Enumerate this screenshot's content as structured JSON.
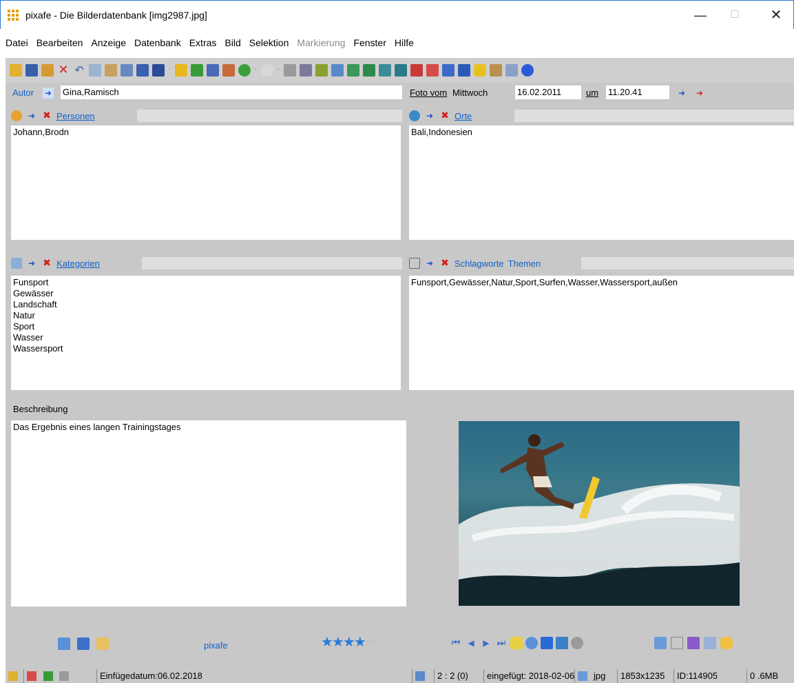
{
  "window": {
    "title": "pixafe - Die Bilderdatenbank  [img2987.jpg]",
    "minimize": "—",
    "maximize": "☐",
    "close": "✕"
  },
  "menu": [
    {
      "label": "Datei",
      "enabled": true
    },
    {
      "label": "Bearbeiten",
      "enabled": true
    },
    {
      "label": "Anzeige",
      "enabled": true
    },
    {
      "label": "Datenbank",
      "enabled": true
    },
    {
      "label": "Extras",
      "enabled": true
    },
    {
      "label": "Bild",
      "enabled": true
    },
    {
      "label": "Selektion",
      "enabled": true
    },
    {
      "label": "Markierung",
      "enabled": false
    },
    {
      "label": "Fenster",
      "enabled": true
    },
    {
      "label": "Hilfe",
      "enabled": true
    }
  ],
  "author": {
    "label": "Autor",
    "value": "Gina,Ramisch"
  },
  "photo_date": {
    "label": "Foto vom",
    "weekday": "Mittwoch",
    "date": "16.02.2011",
    "um_label": "um",
    "time": "11.20.41"
  },
  "persons": {
    "header": "Personen",
    "content": "Johann,Brodn"
  },
  "places": {
    "header": "Orte",
    "content": "Bali,Indonesien"
  },
  "categories": {
    "header": "Kategorien",
    "content": "Funsport\nGewässer\nLandschaft\nNatur\nSport\nWasser\nWassersport"
  },
  "keywords": {
    "header": "Schlagworte",
    "header2": "Themen",
    "content": "Funsport,Gewässer,Natur,Sport,Surfen,Wasser,Wassersport,außen"
  },
  "description": {
    "label": "Beschreibung",
    "content": "Das Ergebnis eines langen Trainingstages"
  },
  "footer": {
    "link": "pixafe",
    "rating": 4,
    "rating_max": 5
  },
  "status": {
    "insert_date": "Einfügedatum:06.02.2018",
    "counter": "2 : 2 (0)",
    "inserted": "eingefügt: 2018-02-06",
    "format": "jpg",
    "dimensions": "1853x1235",
    "id": "ID:114905",
    "size": "0 .6MB"
  }
}
